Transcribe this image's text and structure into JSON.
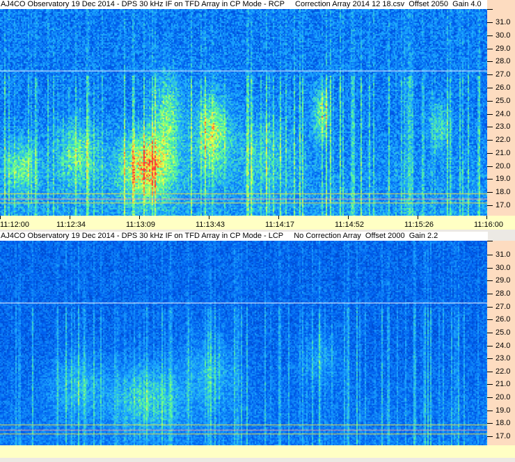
{
  "chart_data": [
    {
      "type": "heatmap",
      "title": "AJ4CO Observatory 19 Dec 2014 - DPS 30 kHz IF on TFD Array in CP Mode - RCP     Correction Array 2014 12 18.csv  Offset 2050  Gain 4.0",
      "y_ticks": [
        "31.0",
        "30.0",
        "29.0",
        "28.0",
        "27.0",
        "26.0",
        "25.0",
        "24.0",
        "23.0",
        "22.0",
        "21.0",
        "20.0",
        "19.0",
        "18.0",
        "17.0"
      ],
      "ylim": [
        16.0,
        32.0
      ],
      "x_ticks": [
        "11:12:00",
        "11:12:34",
        "11:13:09",
        "11:13:43",
        "11:14:17",
        "11:14:52",
        "11:15:26",
        "11:16:00"
      ],
      "xlim": [
        "11:12:00",
        "11:16:00"
      ]
    },
    {
      "type": "heatmap",
      "title": "AJ4CO Observatory 19 Dec 2014 - DPS 30 kHz IF on TFD Array in CP Mode - LCP     No Correction Array  Offset 2000  Gain 2.2",
      "y_ticks": [
        "31.0",
        "30.0",
        "29.0",
        "28.0",
        "27.0",
        "26.0",
        "25.0",
        "24.0",
        "23.0",
        "22.0",
        "21.0",
        "20.0",
        "19.0",
        "18.0",
        "17.0"
      ],
      "ylim": [
        16.0,
        32.0
      ],
      "x_ticks": [],
      "xlim": [
        "11:12:00",
        "11:16:00"
      ]
    }
  ],
  "colors": {
    "axis_bg": "#fddcc0",
    "time_band": "#ffffc4",
    "colormap": [
      "#000030",
      "#0028a0",
      "#0060f0",
      "#20b0ff",
      "#60ff90",
      "#ffff40",
      "#ff3030"
    ]
  }
}
